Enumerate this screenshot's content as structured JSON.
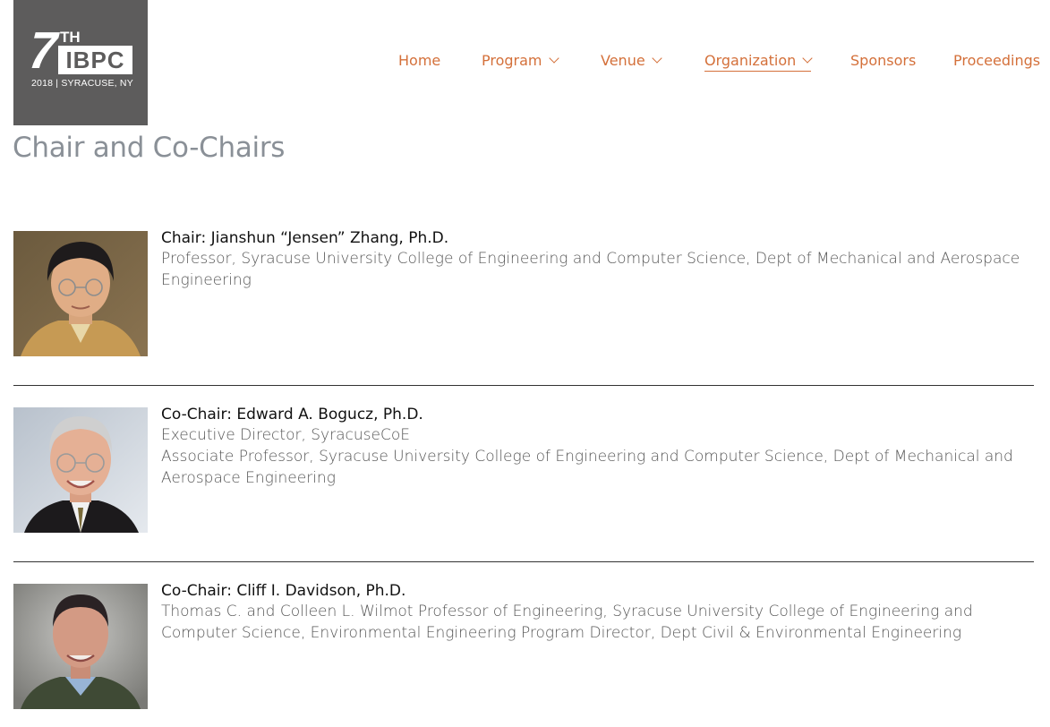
{
  "logo": {
    "number": "7",
    "suffix": "TH",
    "acronym": "IBPC",
    "tagline": "2018 | SYRACUSE, NY"
  },
  "nav": {
    "items": [
      {
        "label": "Home",
        "has_dropdown": false
      },
      {
        "label": "Program",
        "has_dropdown": true
      },
      {
        "label": "Venue",
        "has_dropdown": true
      },
      {
        "label": "Organization",
        "has_dropdown": true,
        "active": true
      },
      {
        "label": "Sponsors",
        "has_dropdown": false
      },
      {
        "label": "Proceedings",
        "has_dropdown": false
      }
    ]
  },
  "page": {
    "title": "Chair and Co-Chairs"
  },
  "people": [
    {
      "name": "Chair: Jianshun “Jensen” Zhang, Ph.D.",
      "lines": [
        "Professor, Syracuse University College of Engineering and Computer Science, Dept of Mechanical and Aerospace Engineering"
      ]
    },
    {
      "name": "Co-Chair: Edward A. Bogucz, Ph.D.",
      "lines": [
        "Executive Director, SyracuseCoE",
        "Associate Professor, Syracuse University College of Engineering and Computer Science, Dept of Mechanical and Aerospace Engineering"
      ]
    },
    {
      "name": "Co-Chair: Cliff I. Davidson, Ph.D.",
      "lines": [
        "Thomas C. and Colleen L. Wilmot Professor of Engineering, Syracuse University College of Engineering and Computer Science, Environmental Engineering Program Director, Dept Civil & Environmental Engineering"
      ]
    }
  ],
  "colors": {
    "accent": "#d4703a",
    "title": "#8a9097",
    "logo_bg": "#5d5c5c"
  }
}
